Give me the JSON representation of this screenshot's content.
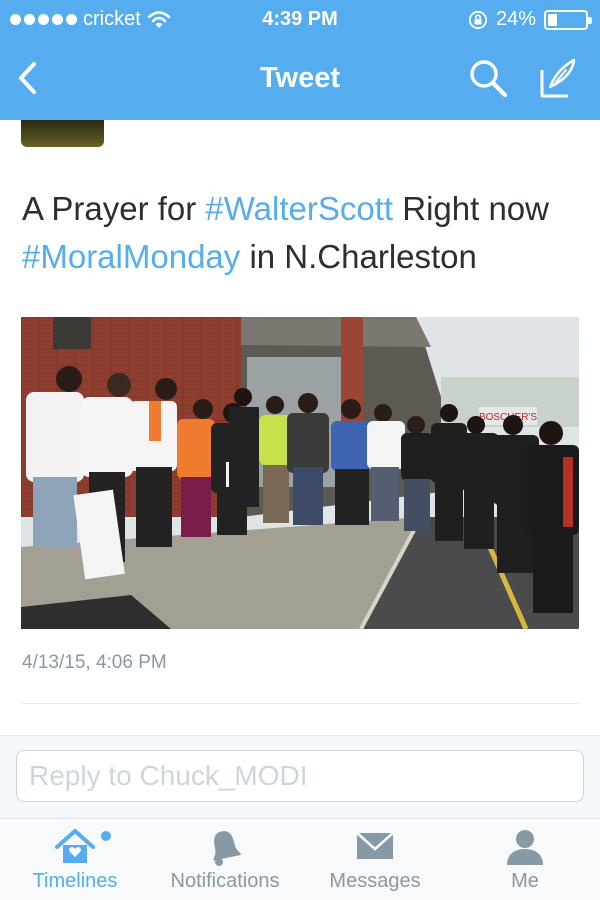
{
  "status_bar": {
    "carrier": "cricket",
    "time": "4:39 PM",
    "battery_percent": "24%",
    "battery_level": 0.24,
    "icons": [
      "signal-dots-icon",
      "wifi-icon",
      "rotation-lock-icon",
      "battery-icon"
    ]
  },
  "nav": {
    "title": "Tweet",
    "icons": [
      "back-chevron-icon",
      "search-icon",
      "compose-icon"
    ]
  },
  "tweet": {
    "text_part1": "A Prayer for ",
    "hashtag1": "#WalterScott",
    "text_part2": " Right now ",
    "hashtag2": "#MoralMonday",
    "text_part3": " in N.Charleston",
    "timestamp": "4/13/15, 4:06 PM",
    "photo_sign_text": "BOSCHER'S"
  },
  "reply": {
    "placeholder": "Reply to Chuck_MODI"
  },
  "tabs": [
    {
      "label": "Timelines",
      "icon": "home-icon",
      "active": true
    },
    {
      "label": "Notifications",
      "icon": "bell-icon",
      "active": false
    },
    {
      "label": "Messages",
      "icon": "envelope-icon",
      "active": false
    },
    {
      "label": "Me",
      "icon": "person-icon",
      "active": false
    }
  ],
  "colors": {
    "brand_blue": "#55acee",
    "text": "#292f33",
    "muted": "#8899a6",
    "tab_inactive_icon": "#8899a6"
  }
}
